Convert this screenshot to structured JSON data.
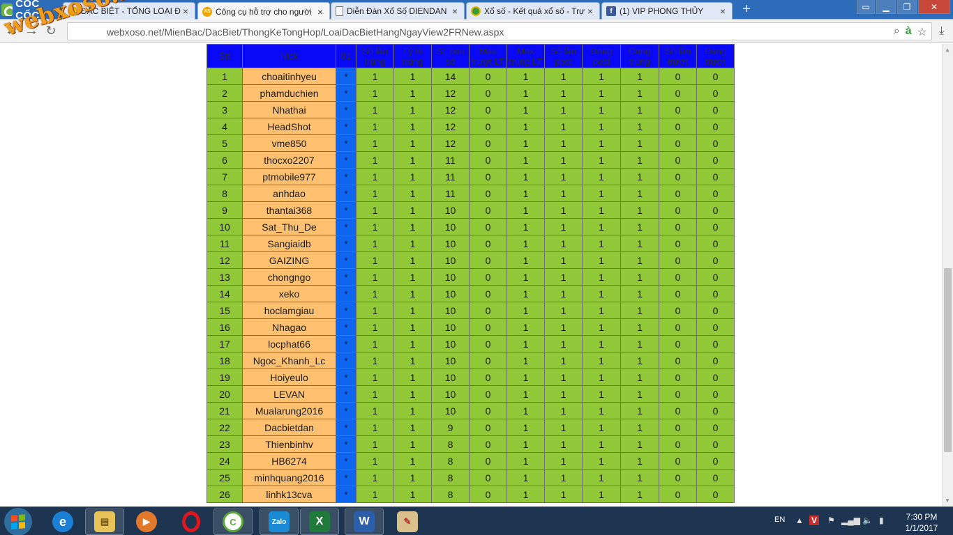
{
  "browser": {
    "brand": "CỐC CỐC",
    "tabs": [
      {
        "title": "ĐẶC BIỆT - TỔNG LOẠI ĐẶ",
        "icon": "xs-favicon-icon",
        "active": false
      },
      {
        "title": "Công cụ hỗ trợ cho người",
        "icon": "xs-favicon-icon",
        "active": true
      },
      {
        "title": "Diễn Đàn Xổ Số DIENDAN",
        "icon": "document-icon",
        "active": false
      },
      {
        "title": "Xổ số - Kết quả xổ số - Trự",
        "icon": "coccoc-icon",
        "active": false
      },
      {
        "title": "(1) VIP PHONG THỦY",
        "icon": "facebook-icon",
        "active": false
      }
    ],
    "url": "webxoso.net/MienBac/DacBiet/ThongKeTongHop/LoaiDacBietHangNgayView2FRNew.aspx",
    "watermark": "webxoso.net"
  },
  "table": {
    "headers": [
      "Stt",
      "Nick",
      "01",
      "Số lần trúng",
      "Tỷ lệ trúng",
      "SL con số",
      "Max trượt LT",
      "Max trúng LT",
      "Số lần post",
      "Đang post",
      "Đang trúng",
      "Số lần trượt",
      "Đang trượt"
    ],
    "rows": [
      [
        "1",
        "choaitinhyeu",
        "*",
        "1",
        "1",
        "14",
        "0",
        "1",
        "1",
        "1",
        "1",
        "0",
        "0"
      ],
      [
        "2",
        "phamduchien",
        "*",
        "1",
        "1",
        "12",
        "0",
        "1",
        "1",
        "1",
        "1",
        "0",
        "0"
      ],
      [
        "3",
        "Nhathai",
        "*",
        "1",
        "1",
        "12",
        "0",
        "1",
        "1",
        "1",
        "1",
        "0",
        "0"
      ],
      [
        "4",
        "HeadShot",
        "*",
        "1",
        "1",
        "12",
        "0",
        "1",
        "1",
        "1",
        "1",
        "0",
        "0"
      ],
      [
        "5",
        "vme850",
        "*",
        "1",
        "1",
        "12",
        "0",
        "1",
        "1",
        "1",
        "1",
        "0",
        "0"
      ],
      [
        "6",
        "thocxo2207",
        "*",
        "1",
        "1",
        "11",
        "0",
        "1",
        "1",
        "1",
        "1",
        "0",
        "0"
      ],
      [
        "7",
        "ptmobile977",
        "*",
        "1",
        "1",
        "11",
        "0",
        "1",
        "1",
        "1",
        "1",
        "0",
        "0"
      ],
      [
        "8",
        "anhdao",
        "*",
        "1",
        "1",
        "11",
        "0",
        "1",
        "1",
        "1",
        "1",
        "0",
        "0"
      ],
      [
        "9",
        "thantai368",
        "*",
        "1",
        "1",
        "10",
        "0",
        "1",
        "1",
        "1",
        "1",
        "0",
        "0"
      ],
      [
        "10",
        "Sat_Thu_De",
        "*",
        "1",
        "1",
        "10",
        "0",
        "1",
        "1",
        "1",
        "1",
        "0",
        "0"
      ],
      [
        "11",
        "Sangiaidb",
        "*",
        "1",
        "1",
        "10",
        "0",
        "1",
        "1",
        "1",
        "1",
        "0",
        "0"
      ],
      [
        "12",
        "GAIZING",
        "*",
        "1",
        "1",
        "10",
        "0",
        "1",
        "1",
        "1",
        "1",
        "0",
        "0"
      ],
      [
        "13",
        "chongngo",
        "*",
        "1",
        "1",
        "10",
        "0",
        "1",
        "1",
        "1",
        "1",
        "0",
        "0"
      ],
      [
        "14",
        "xeko",
        "*",
        "1",
        "1",
        "10",
        "0",
        "1",
        "1",
        "1",
        "1",
        "0",
        "0"
      ],
      [
        "15",
        "hoclamgiau",
        "*",
        "1",
        "1",
        "10",
        "0",
        "1",
        "1",
        "1",
        "1",
        "0",
        "0"
      ],
      [
        "16",
        "Nhagao",
        "*",
        "1",
        "1",
        "10",
        "0",
        "1",
        "1",
        "1",
        "1",
        "0",
        "0"
      ],
      [
        "17",
        "locphat66",
        "*",
        "1",
        "1",
        "10",
        "0",
        "1",
        "1",
        "1",
        "1",
        "0",
        "0"
      ],
      [
        "18",
        "Ngoc_Khanh_Lc",
        "*",
        "1",
        "1",
        "10",
        "0",
        "1",
        "1",
        "1",
        "1",
        "0",
        "0"
      ],
      [
        "19",
        "Hoiyeulo",
        "*",
        "1",
        "1",
        "10",
        "0",
        "1",
        "1",
        "1",
        "1",
        "0",
        "0"
      ],
      [
        "20",
        "LEVAN",
        "*",
        "1",
        "1",
        "10",
        "0",
        "1",
        "1",
        "1",
        "1",
        "0",
        "0"
      ],
      [
        "21",
        "Mualarung2016",
        "*",
        "1",
        "1",
        "10",
        "0",
        "1",
        "1",
        "1",
        "1",
        "0",
        "0"
      ],
      [
        "22",
        "Dacbietdan",
        "*",
        "1",
        "1",
        "9",
        "0",
        "1",
        "1",
        "1",
        "1",
        "0",
        "0"
      ],
      [
        "23",
        "Thienbinhv",
        "*",
        "1",
        "1",
        "8",
        "0",
        "1",
        "1",
        "1",
        "1",
        "0",
        "0"
      ],
      [
        "24",
        "HB6274",
        "*",
        "1",
        "1",
        "8",
        "0",
        "1",
        "1",
        "1",
        "1",
        "0",
        "0"
      ],
      [
        "25",
        "minhquang2016",
        "*",
        "1",
        "1",
        "8",
        "0",
        "1",
        "1",
        "1",
        "1",
        "0",
        "0"
      ],
      [
        "26",
        "linhk13cva",
        "*",
        "1",
        "1",
        "8",
        "0",
        "1",
        "1",
        "1",
        "1",
        "0",
        "0"
      ]
    ]
  },
  "taskbar": {
    "apps": [
      "internet-explorer-icon",
      "file-explorer-icon",
      "media-player-icon",
      "opera-icon",
      "coccoc-icon",
      "zalo-icon",
      "excel-icon",
      "word-icon",
      "paint-icon"
    ],
    "zalo_label": "Zalo",
    "language": "EN",
    "time": "7:30 PM",
    "date": "1/1/2017"
  },
  "colors": {
    "header_bg": "#0909f6",
    "row_bg": "#91c837",
    "nick_bg": "#ffc16f",
    "mark_bg": "#0d65f0",
    "titlebar": "#2d6cb8"
  }
}
